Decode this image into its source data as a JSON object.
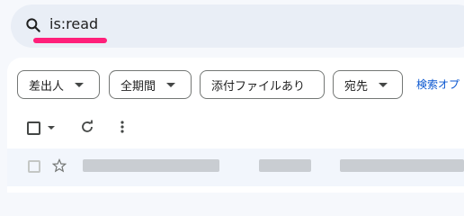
{
  "search": {
    "query": "is:read",
    "icon": "search-icon"
  },
  "filters": {
    "chips": [
      {
        "label": "差出人"
      },
      {
        "label": "全期間"
      },
      {
        "label": "添付ファイルあり"
      },
      {
        "label": "宛先"
      }
    ],
    "advanced_link": "検索オプ"
  },
  "toolbar": {
    "icons": [
      "checkbox",
      "chevron-down-icon",
      "refresh-icon",
      "more-vert-icon"
    ]
  },
  "colors": {
    "highlight": "#ff1f7a",
    "link": "#0b57d0"
  }
}
